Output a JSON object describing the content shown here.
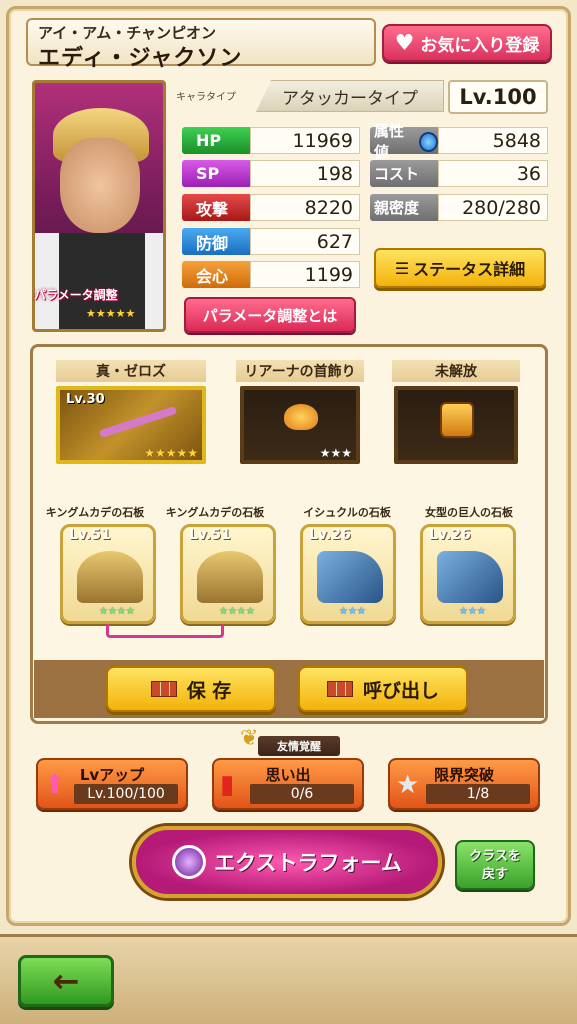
{
  "character": {
    "title": "アイ・アム・チャンピオン",
    "name": "エディ・ジャクソン",
    "type_label": "キャラタイプ",
    "type": "アタッカータイプ",
    "level": "Lv.100",
    "param_label": "パラメータ調整",
    "rarity_stars": "★★★★★"
  },
  "favorite_label": "お気に入り登録",
  "stats": {
    "hp": {
      "label": "HP",
      "value": "11969"
    },
    "sp": {
      "label": "SP",
      "value": "198"
    },
    "atk": {
      "label": "攻撃",
      "value": "8220"
    },
    "def": {
      "label": "防御",
      "value": "627"
    },
    "crit": {
      "label": "会心",
      "value": "1199"
    },
    "attr": {
      "label": "属性値",
      "value": "5848"
    },
    "cost": {
      "label": "コスト",
      "value": "36"
    },
    "intimacy": {
      "label": "親密度",
      "value": "280/280"
    }
  },
  "status_detail_label": "ステータス詳細",
  "param_info_label": "パラメータ調整とは",
  "equipment": [
    {
      "title": "真・ゼロズ",
      "level": "Lv.30",
      "stars": "★★★★★"
    },
    {
      "title": "リアーナの首飾り",
      "level": "",
      "stars": "★★★"
    },
    {
      "title": "未解放",
      "level": "",
      "stars": ""
    }
  ],
  "tablets": [
    {
      "title": "キングムカデの石板",
      "level": "Lv.51",
      "stars": "★★★★"
    },
    {
      "title": "キングムカデの石板",
      "level": "Lv.51",
      "stars": "★★★★"
    },
    {
      "title": "イシュクルの石板",
      "level": "Lv.26",
      "stars": "★★★"
    },
    {
      "title": "女型の巨人の石板",
      "level": "Lv.26",
      "stars": "★★★"
    }
  ],
  "save_label": "保 存",
  "call_label": "呼び出し",
  "friendship_tag": "友情覚醒",
  "actions": {
    "lvup": {
      "title": "Lvアップ",
      "value": "Lv.100/100"
    },
    "memory": {
      "title": "思い出",
      "value": "0/6"
    },
    "limit": {
      "title": "限界突破",
      "value": "1/8"
    }
  },
  "extra_form_label": "エクストラフォーム",
  "class_return_line1": "クラスを",
  "class_return_line2": "戻す",
  "back_icon": "←",
  "colors": {
    "hp": "#22b03a",
    "sp": "#c23bd6",
    "atk": "#d32b2b",
    "def": "#2a8fe0",
    "crit": "#f08a1c"
  }
}
